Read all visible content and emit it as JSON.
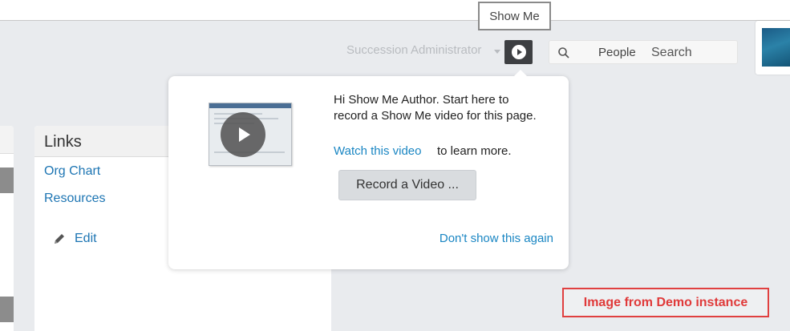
{
  "header": {
    "tooltip": "Show Me",
    "role_label": "Succession Administrator",
    "search": {
      "scope": "People",
      "placeholder": "Search"
    }
  },
  "links_panel": {
    "title": "Links",
    "items": [
      "Org Chart",
      "Resources"
    ],
    "edit_label": "Edit"
  },
  "show_me_popover": {
    "message": "Hi Show Me Author. Start here to record a Show Me video for this page.",
    "watch_link": "Watch this video",
    "watch_suffix": "to learn more.",
    "record_button": "Record a Video ...",
    "dismiss_link": "Don't show this again"
  },
  "demo_label": "Image from Demo instance",
  "colors": {
    "link": "#1a86c3",
    "play_button": "#3d3f42",
    "demo_border": "#e04040"
  }
}
